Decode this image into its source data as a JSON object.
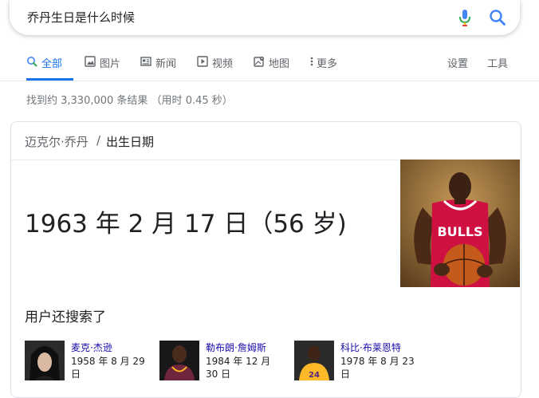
{
  "search": {
    "query": "乔丹生日是什么时候"
  },
  "tabs": [
    {
      "label": "全部",
      "icon": "search-icon",
      "active": true
    },
    {
      "label": "图片",
      "icon": "image-icon"
    },
    {
      "label": "新闻",
      "icon": "news-icon"
    },
    {
      "label": "视频",
      "icon": "video-icon"
    },
    {
      "label": "地图",
      "icon": "map-icon"
    },
    {
      "label": "更多",
      "icon": "more-vertical-icon"
    }
  ],
  "tools": {
    "settings": "设置",
    "tools": "工具"
  },
  "result_stats": "找到约 3,330,000 条结果 （用时 0.45 秒）",
  "card": {
    "breadcrumb_link": "迈克尔·乔丹",
    "breadcrumb_sep": "/",
    "breadcrumb_title": "出生日期",
    "answer": "1963 年 2 月 17 日（56 岁)",
    "also_searched_heading": "用户还搜索了",
    "people": [
      {
        "name": "麦克·杰逊",
        "date": "1958 年 8 月 29 日"
      },
      {
        "name": "勒布朗·詹姆斯",
        "date": "1984 年 12 月 30 日"
      },
      {
        "name": "科比·布莱恩特",
        "date": "1978 年 8 月 23 日"
      }
    ]
  },
  "colors": {
    "accent": "#1a73e8",
    "link": "#1a0dab",
    "bulls_red": "#ce1141"
  }
}
